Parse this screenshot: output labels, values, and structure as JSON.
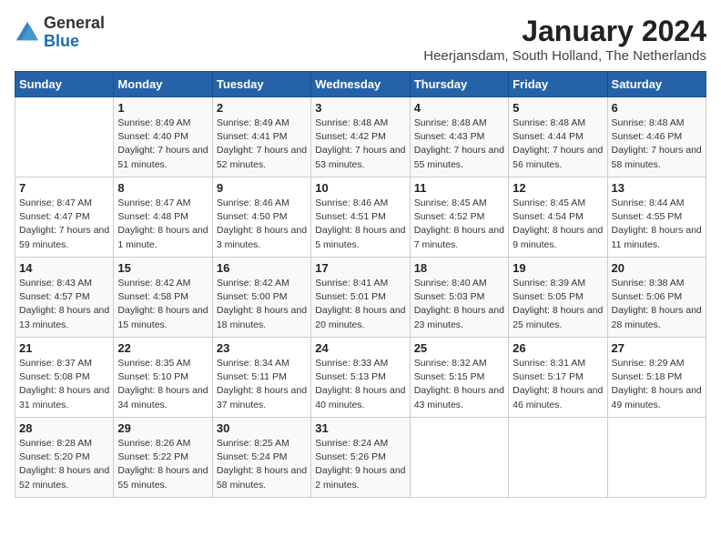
{
  "header": {
    "logo_general": "General",
    "logo_blue": "Blue",
    "month_title": "January 2024",
    "location": "Heerjansdam, South Holland, The Netherlands"
  },
  "days_of_week": [
    "Sunday",
    "Monday",
    "Tuesday",
    "Wednesday",
    "Thursday",
    "Friday",
    "Saturday"
  ],
  "weeks": [
    [
      {
        "day": "",
        "info": ""
      },
      {
        "day": "1",
        "info": "Sunrise: 8:49 AM\nSunset: 4:40 PM\nDaylight: 7 hours\nand 51 minutes."
      },
      {
        "day": "2",
        "info": "Sunrise: 8:49 AM\nSunset: 4:41 PM\nDaylight: 7 hours\nand 52 minutes."
      },
      {
        "day": "3",
        "info": "Sunrise: 8:48 AM\nSunset: 4:42 PM\nDaylight: 7 hours\nand 53 minutes."
      },
      {
        "day": "4",
        "info": "Sunrise: 8:48 AM\nSunset: 4:43 PM\nDaylight: 7 hours\nand 55 minutes."
      },
      {
        "day": "5",
        "info": "Sunrise: 8:48 AM\nSunset: 4:44 PM\nDaylight: 7 hours\nand 56 minutes."
      },
      {
        "day": "6",
        "info": "Sunrise: 8:48 AM\nSunset: 4:46 PM\nDaylight: 7 hours\nand 58 minutes."
      }
    ],
    [
      {
        "day": "7",
        "info": "Sunrise: 8:47 AM\nSunset: 4:47 PM\nDaylight: 7 hours\nand 59 minutes."
      },
      {
        "day": "8",
        "info": "Sunrise: 8:47 AM\nSunset: 4:48 PM\nDaylight: 8 hours\nand 1 minute."
      },
      {
        "day": "9",
        "info": "Sunrise: 8:46 AM\nSunset: 4:50 PM\nDaylight: 8 hours\nand 3 minutes."
      },
      {
        "day": "10",
        "info": "Sunrise: 8:46 AM\nSunset: 4:51 PM\nDaylight: 8 hours\nand 5 minutes."
      },
      {
        "day": "11",
        "info": "Sunrise: 8:45 AM\nSunset: 4:52 PM\nDaylight: 8 hours\nand 7 minutes."
      },
      {
        "day": "12",
        "info": "Sunrise: 8:45 AM\nSunset: 4:54 PM\nDaylight: 8 hours\nand 9 minutes."
      },
      {
        "day": "13",
        "info": "Sunrise: 8:44 AM\nSunset: 4:55 PM\nDaylight: 8 hours\nand 11 minutes."
      }
    ],
    [
      {
        "day": "14",
        "info": "Sunrise: 8:43 AM\nSunset: 4:57 PM\nDaylight: 8 hours\nand 13 minutes."
      },
      {
        "day": "15",
        "info": "Sunrise: 8:42 AM\nSunset: 4:58 PM\nDaylight: 8 hours\nand 15 minutes."
      },
      {
        "day": "16",
        "info": "Sunrise: 8:42 AM\nSunset: 5:00 PM\nDaylight: 8 hours\nand 18 minutes."
      },
      {
        "day": "17",
        "info": "Sunrise: 8:41 AM\nSunset: 5:01 PM\nDaylight: 8 hours\nand 20 minutes."
      },
      {
        "day": "18",
        "info": "Sunrise: 8:40 AM\nSunset: 5:03 PM\nDaylight: 8 hours\nand 23 minutes."
      },
      {
        "day": "19",
        "info": "Sunrise: 8:39 AM\nSunset: 5:05 PM\nDaylight: 8 hours\nand 25 minutes."
      },
      {
        "day": "20",
        "info": "Sunrise: 8:38 AM\nSunset: 5:06 PM\nDaylight: 8 hours\nand 28 minutes."
      }
    ],
    [
      {
        "day": "21",
        "info": "Sunrise: 8:37 AM\nSunset: 5:08 PM\nDaylight: 8 hours\nand 31 minutes."
      },
      {
        "day": "22",
        "info": "Sunrise: 8:35 AM\nSunset: 5:10 PM\nDaylight: 8 hours\nand 34 minutes."
      },
      {
        "day": "23",
        "info": "Sunrise: 8:34 AM\nSunset: 5:11 PM\nDaylight: 8 hours\nand 37 minutes."
      },
      {
        "day": "24",
        "info": "Sunrise: 8:33 AM\nSunset: 5:13 PM\nDaylight: 8 hours\nand 40 minutes."
      },
      {
        "day": "25",
        "info": "Sunrise: 8:32 AM\nSunset: 5:15 PM\nDaylight: 8 hours\nand 43 minutes."
      },
      {
        "day": "26",
        "info": "Sunrise: 8:31 AM\nSunset: 5:17 PM\nDaylight: 8 hours\nand 46 minutes."
      },
      {
        "day": "27",
        "info": "Sunrise: 8:29 AM\nSunset: 5:18 PM\nDaylight: 8 hours\nand 49 minutes."
      }
    ],
    [
      {
        "day": "28",
        "info": "Sunrise: 8:28 AM\nSunset: 5:20 PM\nDaylight: 8 hours\nand 52 minutes."
      },
      {
        "day": "29",
        "info": "Sunrise: 8:26 AM\nSunset: 5:22 PM\nDaylight: 8 hours\nand 55 minutes."
      },
      {
        "day": "30",
        "info": "Sunrise: 8:25 AM\nSunset: 5:24 PM\nDaylight: 8 hours\nand 58 minutes."
      },
      {
        "day": "31",
        "info": "Sunrise: 8:24 AM\nSunset: 5:26 PM\nDaylight: 9 hours\nand 2 minutes."
      },
      {
        "day": "",
        "info": ""
      },
      {
        "day": "",
        "info": ""
      },
      {
        "day": "",
        "info": ""
      }
    ]
  ]
}
